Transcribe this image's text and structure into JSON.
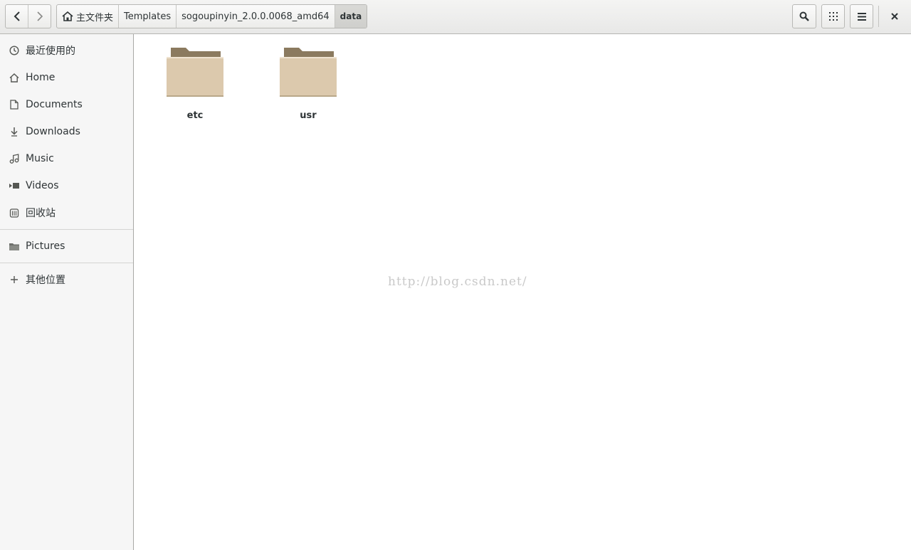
{
  "breadcrumbs": [
    {
      "label": "主文件夹",
      "icon": "home-icon"
    },
    {
      "label": "Templates"
    },
    {
      "label": "sogoupinyin_2.0.0.0068_amd64"
    },
    {
      "label": "data",
      "active": true
    }
  ],
  "sidebar": {
    "items": [
      {
        "label": "最近使用的",
        "icon": "recent-icon"
      },
      {
        "label": "Home",
        "icon": "home-icon"
      },
      {
        "label": "Documents",
        "icon": "document-icon"
      },
      {
        "label": "Downloads",
        "icon": "download-icon"
      },
      {
        "label": "Music",
        "icon": "music-icon"
      },
      {
        "label": "Videos",
        "icon": "video-icon"
      },
      {
        "label": "回收站",
        "icon": "trash-icon"
      },
      {
        "label": "Pictures",
        "icon": "folder-icon"
      },
      {
        "label": "其他位置",
        "icon": "plus-icon"
      }
    ]
  },
  "files": [
    {
      "name": "etc",
      "type": "folder"
    },
    {
      "name": "usr",
      "type": "folder"
    }
  ],
  "watermark": "http://blog.csdn.net/",
  "colors": {
    "folder_body": "#dcc9ad",
    "folder_tab": "#8b7a5f"
  }
}
